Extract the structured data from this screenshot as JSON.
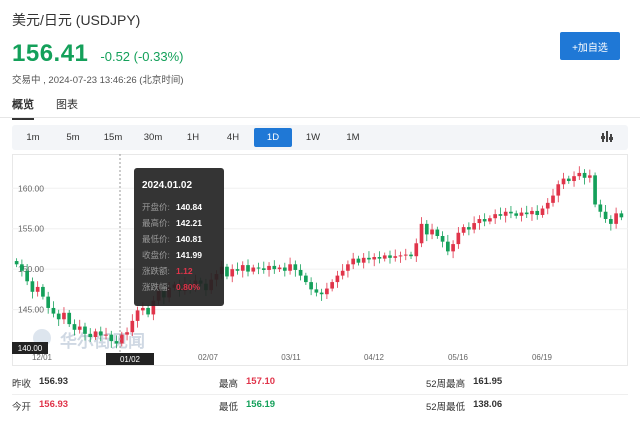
{
  "header": {
    "title": "美元/日元 (USDJPY)",
    "price": "156.41",
    "change": "-0.52 (-0.33%)",
    "status": "交易中 , 2024-07-23 13:46:26 (北京时间)",
    "add_button": "+加自选"
  },
  "tabs": [
    {
      "label": "概览",
      "active": true
    },
    {
      "label": "图表",
      "active": false
    }
  ],
  "periods": [
    {
      "label": "1m",
      "active": false
    },
    {
      "label": "5m",
      "active": false
    },
    {
      "label": "15m",
      "active": false
    },
    {
      "label": "30m",
      "active": false
    },
    {
      "label": "1H",
      "active": false
    },
    {
      "label": "4H",
      "active": false
    },
    {
      "label": "1D",
      "active": true
    },
    {
      "label": "1W",
      "active": false
    },
    {
      "label": "1M",
      "active": false
    }
  ],
  "chart_data": {
    "type": "candlestick",
    "y_ticks": [
      "160.00",
      "155.00",
      "150.00",
      "145.00"
    ],
    "x_ticks": [
      "12/01",
      "01/02",
      "02/07",
      "03/11",
      "04/12",
      "05/16",
      "06/19"
    ],
    "ylim": [
      140,
      163.5
    ],
    "crosshair_x_label": "01/02",
    "crosshair_y_label": "140.00",
    "watermark": "华尔街见闻",
    "up_color": "#e0344a",
    "down_color": "#14a05a",
    "closes": [
      150.6,
      149.8,
      148.5,
      147.2,
      147.8,
      146.6,
      145.2,
      144.5,
      143.8,
      144.6,
      143.2,
      142.5,
      142.9,
      142.0,
      141.6,
      142.3,
      141.8,
      141.9,
      141.1,
      140.8,
      141.9,
      142.2,
      143.6,
      144.9,
      145.2,
      144.4,
      146.1,
      147.3,
      146.5,
      147.7,
      148.1,
      147.3,
      148.2,
      147.8,
      148.6,
      148.2,
      147.4,
      148.7,
      149.4,
      150.3,
      149.1,
      150.0,
      149.8,
      150.5,
      149.7,
      150.2,
      150.1,
      149.9,
      150.4,
      150.0,
      150.2,
      149.8,
      150.6,
      149.9,
      149.2,
      148.4,
      147.5,
      147.1,
      146.9,
      147.6,
      148.4,
      149.2,
      149.8,
      150.6,
      151.3,
      150.8,
      151.4,
      151.2,
      151.5,
      151.3,
      151.7,
      151.4,
      151.6,
      151.7,
      151.8,
      151.6,
      153.2,
      155.6,
      154.3,
      154.9,
      154.1,
      153.4,
      152.2,
      153.1,
      154.5,
      155.2,
      154.9,
      155.7,
      156.2,
      155.9,
      156.3,
      156.8,
      156.6,
      157.1,
      156.9,
      156.6,
      157.0,
      156.8,
      157.2,
      156.7,
      157.5,
      158.2,
      159.1,
      160.5,
      161.2,
      160.9,
      161.5,
      161.9,
      161.3,
      161.6,
      158.0,
      157.1,
      156.2,
      155.6,
      156.9,
      156.41
    ],
    "tooltip": {
      "date": "2024.01.02",
      "rows": [
        {
          "key": "开盘价:",
          "value": "140.84",
          "color": "#ffffff"
        },
        {
          "key": "最高价:",
          "value": "142.21",
          "color": "#ffffff"
        },
        {
          "key": "最低价:",
          "value": "140.81",
          "color": "#ffffff"
        },
        {
          "key": "收盘价:",
          "value": "141.99",
          "color": "#ffffff"
        },
        {
          "key": "涨跌额:",
          "value": "1.12",
          "color": "#e0344a"
        },
        {
          "key": "涨跌幅:",
          "value": "0.80%",
          "color": "#e0344a"
        }
      ]
    }
  },
  "stats": [
    [
      {
        "label": "昨收",
        "value": "156.93",
        "tone": ""
      },
      {
        "label": "最高",
        "value": "157.10",
        "tone": "red"
      },
      {
        "label": "52周最高",
        "value": "161.95",
        "tone": ""
      }
    ],
    [
      {
        "label": "今开",
        "value": "156.93",
        "tone": "red"
      },
      {
        "label": "最低",
        "value": "156.19",
        "tone": "green"
      },
      {
        "label": "52周最低",
        "value": "138.06",
        "tone": ""
      }
    ]
  ]
}
